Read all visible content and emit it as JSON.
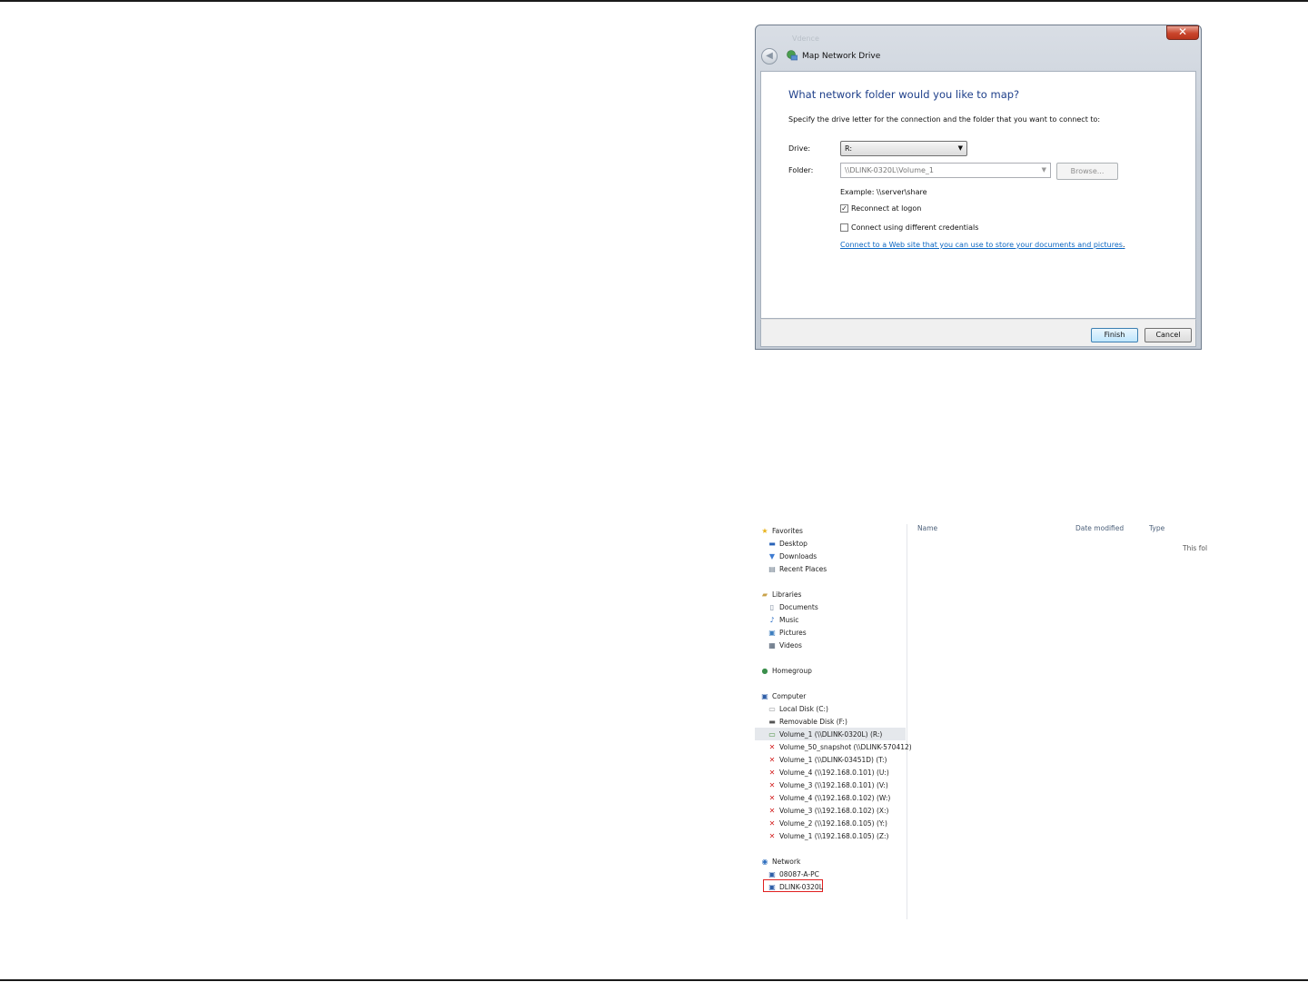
{
  "dialog": {
    "close_glyph": "✕",
    "ghost_text": "Vdence",
    "title": "Map Network Drive",
    "heading": "What network folder would you like to map?",
    "instruction": "Specify the drive letter for the connection and the folder that you want to connect to:",
    "drive_label": "Drive:",
    "drive_value": "R:",
    "folder_label": "Folder:",
    "folder_value": "\\\\DLINK-0320L\\Volume_1",
    "browse_label": "Browse...",
    "example": "Example: \\\\server\\share",
    "reconnect_label": "Reconnect at logon",
    "reconnect_checked": true,
    "credentials_label": "Connect using different credentials",
    "credentials_checked": false,
    "web_link": "Connect to a Web site that you can use to store your documents and pictures",
    "web_link_suffix": ".",
    "finish_label": "Finish",
    "cancel_label": "Cancel"
  },
  "explorer": {
    "columns": [
      "Name",
      "Date modified",
      "Type"
    ],
    "empty_message": "This fol",
    "nav_items": [
      {
        "label": "Favorites",
        "icon": "star-icon",
        "level": 0
      },
      {
        "label": "Desktop",
        "icon": "desktop-icon",
        "level": 1
      },
      {
        "label": "Downloads",
        "icon": "downloads-icon",
        "level": 1
      },
      {
        "label": "Recent Places",
        "icon": "recent-places-icon",
        "level": 1
      },
      {
        "label": "Libraries",
        "icon": "libraries-icon",
        "level": 0
      },
      {
        "label": "Documents",
        "icon": "documents-icon",
        "level": 1
      },
      {
        "label": "Music",
        "icon": "music-icon",
        "level": 1
      },
      {
        "label": "Pictures",
        "icon": "pictures-icon",
        "level": 1
      },
      {
        "label": "Videos",
        "icon": "videos-icon",
        "level": 1
      },
      {
        "label": "Homegroup",
        "icon": "homegroup-icon",
        "level": 0
      },
      {
        "label": "Computer",
        "icon": "computer-icon",
        "level": 0
      },
      {
        "label": "Local Disk (C:)",
        "icon": "local-disk-icon",
        "level": 1
      },
      {
        "label": "Removable Disk (F:)",
        "icon": "removable-disk-icon",
        "level": 1
      },
      {
        "label": "Volume_1 (\\\\DLINK-0320L) (R:)",
        "icon": "network-drive-icon",
        "level": 1,
        "selected": true
      },
      {
        "label": "Volume_50_snapshot (\\\\DLINK-570412)",
        "icon": "disconnected-drive-icon",
        "level": 1
      },
      {
        "label": "Volume_1 (\\\\DLINK-03451D) (T:)",
        "icon": "disconnected-drive-icon",
        "level": 1
      },
      {
        "label": "Volume_4 (\\\\192.168.0.101) (U:)",
        "icon": "disconnected-drive-icon",
        "level": 1
      },
      {
        "label": "Volume_3 (\\\\192.168.0.101) (V:)",
        "icon": "disconnected-drive-icon",
        "level": 1
      },
      {
        "label": "Volume_4 (\\\\192.168.0.102) (W:)",
        "icon": "disconnected-drive-icon",
        "level": 1
      },
      {
        "label": "Volume_3 (\\\\192.168.0.102) (X:)",
        "icon": "disconnected-drive-icon",
        "level": 1
      },
      {
        "label": "Volume_2 (\\\\192.168.0.105) (Y:)",
        "icon": "disconnected-drive-icon",
        "level": 1
      },
      {
        "label": "Volume_1 (\\\\192.168.0.105) (Z:)",
        "icon": "disconnected-drive-icon",
        "level": 1
      },
      {
        "label": "Network",
        "icon": "network-icon",
        "level": 0
      },
      {
        "label": "08087-A-PC",
        "icon": "pc-icon",
        "level": 1
      },
      {
        "label": "DLINK-0320L",
        "icon": "pc-icon",
        "level": 1,
        "highlighted": true
      }
    ]
  },
  "colors": {
    "heading": "#1e3f8a",
    "link": "#0b66c2",
    "highlight_box": "#e02020",
    "disconnected_mark": "#d32020"
  }
}
